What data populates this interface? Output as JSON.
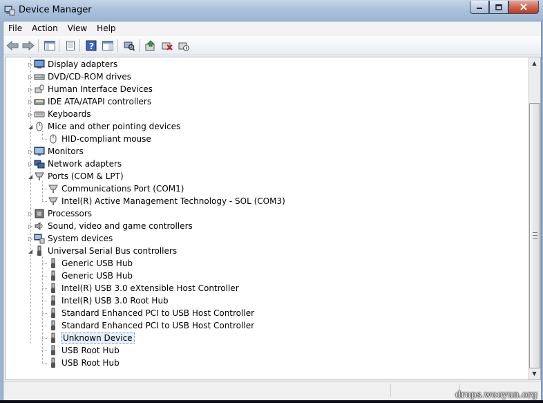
{
  "window": {
    "title": "Device Manager",
    "icon": "device-manager-icon",
    "buttons": {
      "minimize": "minimize-icon",
      "maximize": "maximize-icon",
      "close": "close-icon"
    }
  },
  "menubar": {
    "items": [
      "File",
      "Action",
      "View",
      "Help"
    ]
  },
  "toolbar": {
    "icons": [
      "back-arrow-icon",
      "forward-arrow-icon",
      "show-hide-console-tree-icon",
      "properties-icon",
      "help-icon",
      "action-pane-icon",
      "scan-hardware-icon",
      "update-driver-icon",
      "uninstall-icon",
      "disable-icon"
    ]
  },
  "tree": {
    "items": [
      {
        "label": "Display adapters",
        "icon": "display-adapter-icon",
        "state": "collapsed"
      },
      {
        "label": "DVD/CD-ROM drives",
        "icon": "dvd-drive-icon",
        "state": "collapsed"
      },
      {
        "label": "Human Interface Devices",
        "icon": "hid-icon",
        "state": "collapsed"
      },
      {
        "label": "IDE ATA/ATAPI controllers",
        "icon": "ide-controller-icon",
        "state": "collapsed"
      },
      {
        "label": "Keyboards",
        "icon": "keyboard-icon",
        "state": "collapsed"
      },
      {
        "label": "Mice and other pointing devices",
        "icon": "mouse-icon",
        "state": "expanded",
        "children": [
          "HID-compliant mouse"
        ]
      },
      {
        "label": "Monitors",
        "icon": "monitor-icon",
        "state": "collapsed"
      },
      {
        "label": "Network adapters",
        "icon": "network-adapter-icon",
        "state": "collapsed"
      },
      {
        "label": "Ports (COM & LPT)",
        "icon": "port-icon",
        "state": "expanded",
        "children": [
          "Communications Port (COM1)",
          "Intel(R) Active Management Technology - SOL (COM3)"
        ]
      },
      {
        "label": "Processors",
        "icon": "processor-icon",
        "state": "collapsed"
      },
      {
        "label": "Sound, video and game controllers",
        "icon": "sound-icon",
        "state": "collapsed"
      },
      {
        "label": "System devices",
        "icon": "system-devices-icon",
        "state": "collapsed"
      },
      {
        "label": "Universal Serial Bus controllers",
        "icon": "usb-icon",
        "state": "expanded",
        "children": [
          "Generic USB Hub",
          "Generic USB Hub",
          "Intel(R) USB 3.0 eXtensible Host Controller",
          "Intel(R) USB 3.0 Root Hub",
          "Standard Enhanced PCI to USB Host Controller",
          "Standard Enhanced PCI to USB Host Controller",
          "Unknown Device",
          "USB Root Hub",
          "USB Root Hub"
        ]
      }
    ],
    "selected": "Unknown Device"
  },
  "watermark": "drops.wooyun.org",
  "colors": {
    "selection_bg": "#e5effb",
    "titlebar": "#a9c1dc",
    "close_button": "#c0391e"
  }
}
